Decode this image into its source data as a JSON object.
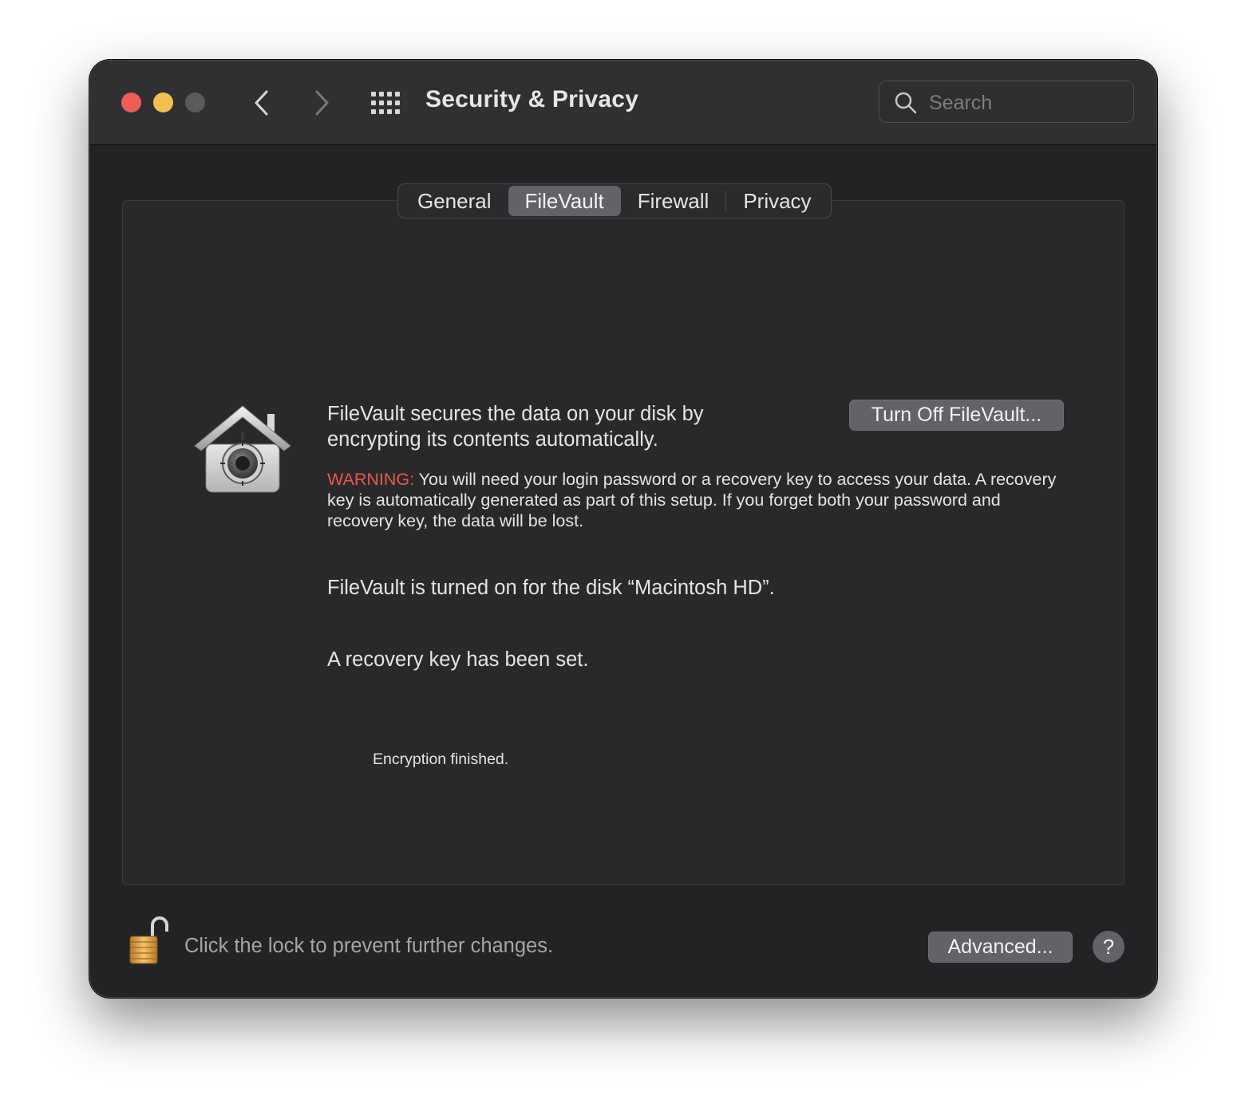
{
  "window": {
    "title": "Security & Privacy",
    "controls": [
      "close",
      "minimize",
      "zoom"
    ]
  },
  "toolbar": {
    "back_icon": "chevron-left-icon",
    "forward_icon": "chevron-right-icon",
    "grid_icon": "grid-icon"
  },
  "search": {
    "placeholder": "Search",
    "value": ""
  },
  "tabs": [
    {
      "label": "General",
      "active": false
    },
    {
      "label": "FileVault",
      "active": true
    },
    {
      "label": "Firewall",
      "active": false
    },
    {
      "label": "Privacy",
      "active": false
    }
  ],
  "filevault": {
    "icon": "filevault-house-icon",
    "description": "FileVault secures the data on your disk by encrypting its contents automatically.",
    "turn_off_button": "Turn Off FileVault...",
    "warning_label": "WARNING:",
    "warning_text": " You will need your login password or a recovery key to access your data. A recovery key is automatically generated as part of this setup. If you forget both your password and recovery key, the data will be lost.",
    "status_disk": "FileVault is turned on for the disk “Macintosh HD”.",
    "status_recovery": "A recovery key has been set.",
    "status_encryption": "Encryption finished."
  },
  "footer": {
    "lock_icon": "unlocked-padlock-icon",
    "lock_label": "Click the lock to prevent further changes.",
    "advanced_button": "Advanced...",
    "help_button": "?"
  },
  "colors": {
    "window_bg": "#232325",
    "titlebar_bg": "#303033",
    "warning": "#e7584d",
    "close": "#ed5e57",
    "minimize": "#f4bf4f",
    "button_bg": "#636367"
  }
}
